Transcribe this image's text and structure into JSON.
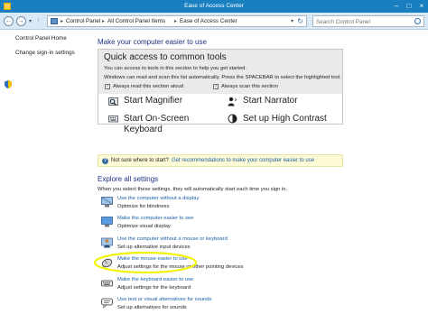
{
  "window": {
    "title": "Ease of Access Center"
  },
  "address_bar": {
    "crumbs": [
      "Control Panel",
      "All Control Panel Items",
      "Ease of Access Center"
    ],
    "search_placeholder": "Search Control Panel"
  },
  "sidebar": {
    "items": [
      {
        "label": "Control Panel Home"
      },
      {
        "label": "Change sign-in settings"
      }
    ]
  },
  "main": {
    "heading": "Make your computer easier to use",
    "quick_access": {
      "title": "Quick access to common tools",
      "line1": "You can access to tools in this section to help you get started.",
      "line2": "Windows can read and scan this list automatically.  Press the SPACEBAR to select the highlighted tool.",
      "always_read": {
        "label": "Always read this section aloud",
        "checked": true
      },
      "always_scan": {
        "label": "Always scan this section",
        "checked": true
      },
      "tools": {
        "magnifier": "Start Magnifier",
        "narrator": "Start Narrator",
        "osk_line1": "Start On-Screen",
        "osk_line2": "Keyboard",
        "high_contrast": "Set up High Contrast"
      }
    },
    "hint": {
      "question": "Not sure where to start?",
      "link": "Get recommendations to make your computer easier to use"
    },
    "explore": {
      "heading": "Explore all settings",
      "subtitle": "When you select these settings, they will automatically start each time you sign in.",
      "items": [
        {
          "link": "Use the computer without a display",
          "desc": "Optimize for blindness",
          "icon": "display-off-icon"
        },
        {
          "link": "Make the computer easier to see",
          "desc": "Optimize visual display",
          "icon": "monitor-icon"
        },
        {
          "link": "Use the computer without a mouse or keyboard",
          "desc": "Set up alternative input devices",
          "icon": "person-icon"
        },
        {
          "link": "Make the mouse easier to use",
          "desc": "Adjust settings for the mouse or other pointing devices",
          "icon": "mouse-icon",
          "highlighted": true
        },
        {
          "link": "Make the keyboard easier to use",
          "desc": "Adjust settings for the keyboard",
          "icon": "keyboard-icon"
        },
        {
          "link": "Use text or visual alternatives for sounds",
          "desc": "Set up alternatives for sounds",
          "icon": "speech-bubble-icon"
        }
      ]
    }
  },
  "colors": {
    "title_bar": "#1a7fc1",
    "heading": "#1e3287",
    "link": "#1a5ea6",
    "hint_bg": "#fdfbd6",
    "highlight_circle": "#f2f20a"
  }
}
